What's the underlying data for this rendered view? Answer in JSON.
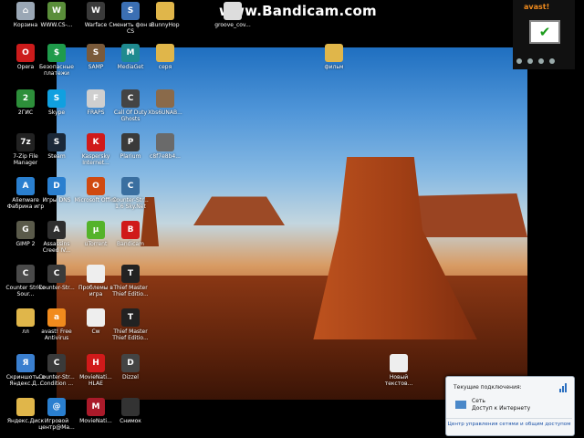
{
  "watermark": "www.Bandicam.com",
  "colors": {
    "wallpaper_sky": "#4f95d8",
    "wallpaper_rock": "#a6431b",
    "avast_orange": "#f18b1d",
    "link_blue": "#1d53a8"
  },
  "icons": [
    {
      "label": "Корзина",
      "icon": "recycle-bin-icon",
      "color": "#9aa7b5",
      "mark": "⌂"
    },
    {
      "label": "WWW.CS-...",
      "icon": "cs-icon",
      "color": "#5a8e3a",
      "mark": "W"
    },
    {
      "label": "Warface",
      "icon": "warface-icon",
      "color": "#3a3a3a",
      "mark": "W"
    },
    {
      "label": "Сменить фон в CS",
      "icon": "shortcut-icon",
      "color": "#3b6fb3",
      "mark": "S"
    },
    {
      "label": "BunnyHop",
      "icon": "folder-icon",
      "color": "#e0b64a",
      "mark": ""
    },
    {
      "label": "groove_cov...",
      "icon": "file-icon",
      "color": "#dddddd",
      "mark": ""
    },
    {
      "label": "Opera",
      "icon": "opera-icon",
      "color": "#cc1b1b",
      "mark": "O"
    },
    {
      "label": "Безопасные платежи",
      "icon": "safe-pay-icon",
      "color": "#1f9b4b",
      "mark": "$"
    },
    {
      "label": "SAMP",
      "icon": "samp-icon",
      "color": "#7a5a3a",
      "mark": "S"
    },
    {
      "label": "MediaGet",
      "icon": "mediaget-icon",
      "color": "#1f8a8f",
      "mark": "M"
    },
    {
      "label": "серя",
      "icon": "folder-icon",
      "color": "#e0b64a",
      "mark": ""
    },
    {
      "label": "фильм",
      "icon": "folder-icon",
      "color": "#e0b64a",
      "mark": ""
    },
    {
      "label": "2ГИС",
      "icon": "2gis-icon",
      "color": "#2d8f3a",
      "mark": "2"
    },
    {
      "label": "Skype",
      "icon": "skype-icon",
      "color": "#10a0e0",
      "mark": "S"
    },
    {
      "label": "FRAPS",
      "icon": "fraps-icon",
      "color": "#cfcfcf",
      "mark": "F"
    },
    {
      "label": "Call Of Duty Ghosts",
      "icon": "cod-icon",
      "color": "#444444",
      "mark": "C"
    },
    {
      "label": "Xbs6UNAB...",
      "icon": "image-icon",
      "color": "#8a6a4a",
      "mark": ""
    },
    {
      "label": "7-Zip File Manager",
      "icon": "7zip-icon",
      "color": "#222222",
      "mark": "7z"
    },
    {
      "label": "Steam",
      "icon": "steam-icon",
      "color": "#1b2838",
      "mark": "S"
    },
    {
      "label": "Kaspersky Internet...",
      "icon": "kaspersky-icon",
      "color": "#d01a1a",
      "mark": "K"
    },
    {
      "label": "Plarium",
      "icon": "plarium-icon",
      "color": "#3a3a3a",
      "mark": "P"
    },
    {
      "label": "c8f7e8b4...",
      "icon": "image-icon",
      "color": "#6a6a6a",
      "mark": ""
    },
    {
      "label": "Alienware Фабрика игр",
      "icon": "alienware-icon",
      "color": "#2a7fcf",
      "mark": "A"
    },
    {
      "label": "Игры DNS",
      "icon": "dns-icon",
      "color": "#2a7fcf",
      "mark": "D"
    },
    {
      "label": "Microsoft Office",
      "icon": "office-icon",
      "color": "#d04a10",
      "mark": "O"
    },
    {
      "label": "Counter-Str... 1.6 Sky.Net",
      "icon": "cs-icon",
      "color": "#3a6fa0",
      "mark": "C"
    },
    {
      "label": "GIMP 2",
      "icon": "gimp-icon",
      "color": "#5a5a4a",
      "mark": "G"
    },
    {
      "label": "Assassins Creed IV...",
      "icon": "ac-icon",
      "color": "#2f2f2f",
      "mark": "A"
    },
    {
      "label": "uTorrent",
      "icon": "utorrent-icon",
      "color": "#54b32a",
      "mark": "μ"
    },
    {
      "label": "Bandicam",
      "icon": "bandicam-icon",
      "color": "#d01a1a",
      "mark": "B"
    },
    {
      "label": "Counter Strike Sour...",
      "icon": "cs-icon",
      "color": "#4a4a4a",
      "mark": "C"
    },
    {
      "label": "Counter-Str...",
      "icon": "cs-icon",
      "color": "#3a3a3a",
      "mark": "C"
    },
    {
      "label": "Проблемы в игра",
      "icon": "document-icon",
      "color": "#eeeeee",
      "mark": ""
    },
    {
      "label": "Thief Master Thief Editio...",
      "icon": "thief-icon",
      "color": "#222222",
      "mark": "T"
    },
    {
      "label": "лл",
      "icon": "folder-icon",
      "color": "#e0b64a",
      "mark": ""
    },
    {
      "label": "avast! Free Antivirus",
      "icon": "avast-icon",
      "color": "#f18b1d",
      "mark": "a"
    },
    {
      "label": "Cw",
      "icon": "document-icon",
      "color": "#eeeeee",
      "mark": ""
    },
    {
      "label": "Thief Master Thief Editio...",
      "icon": "thief-icon",
      "color": "#222222",
      "mark": "T"
    },
    {
      "label": "Новый текстов...",
      "icon": "document-icon",
      "color": "#eeeeee",
      "mark": ""
    },
    {
      "label": "Скриншоты в Яндекс.Д...",
      "icon": "yadisk-icon",
      "color": "#3a7fcf",
      "mark": "Я"
    },
    {
      "label": "Counter-Str... Condition ...",
      "icon": "cs-icon",
      "color": "#3a3a3a",
      "mark": "C"
    },
    {
      "label": "MovieNati... HLAE",
      "icon": "hlae-icon",
      "color": "#d01a1a",
      "mark": "H"
    },
    {
      "label": "Dizzel",
      "icon": "dizzel-icon",
      "color": "#444444",
      "mark": "D"
    },
    {
      "label": "Яндекс.Диск",
      "icon": "yadisk-icon",
      "color": "#e0b64a",
      "mark": ""
    },
    {
      "label": "Игровой центр@Ma...",
      "icon": "mail-games-icon",
      "color": "#2a7fcf",
      "mark": "@"
    },
    {
      "label": "MovieNati...",
      "icon": "movienati-icon",
      "color": "#aa1a2a",
      "mark": "M"
    },
    {
      "label": "Снимок",
      "icon": "image-icon",
      "color": "#333333",
      "mark": ""
    }
  ],
  "avast": {
    "brand": "avast!",
    "status_icon": "checkmark-icon",
    "status_mark": "✔"
  },
  "network_popup": {
    "title": "Текущие подключения:",
    "network_name": "Сеть",
    "network_status": "Доступ к Интернету",
    "link": "Центр управления сетями и общим доступом"
  }
}
